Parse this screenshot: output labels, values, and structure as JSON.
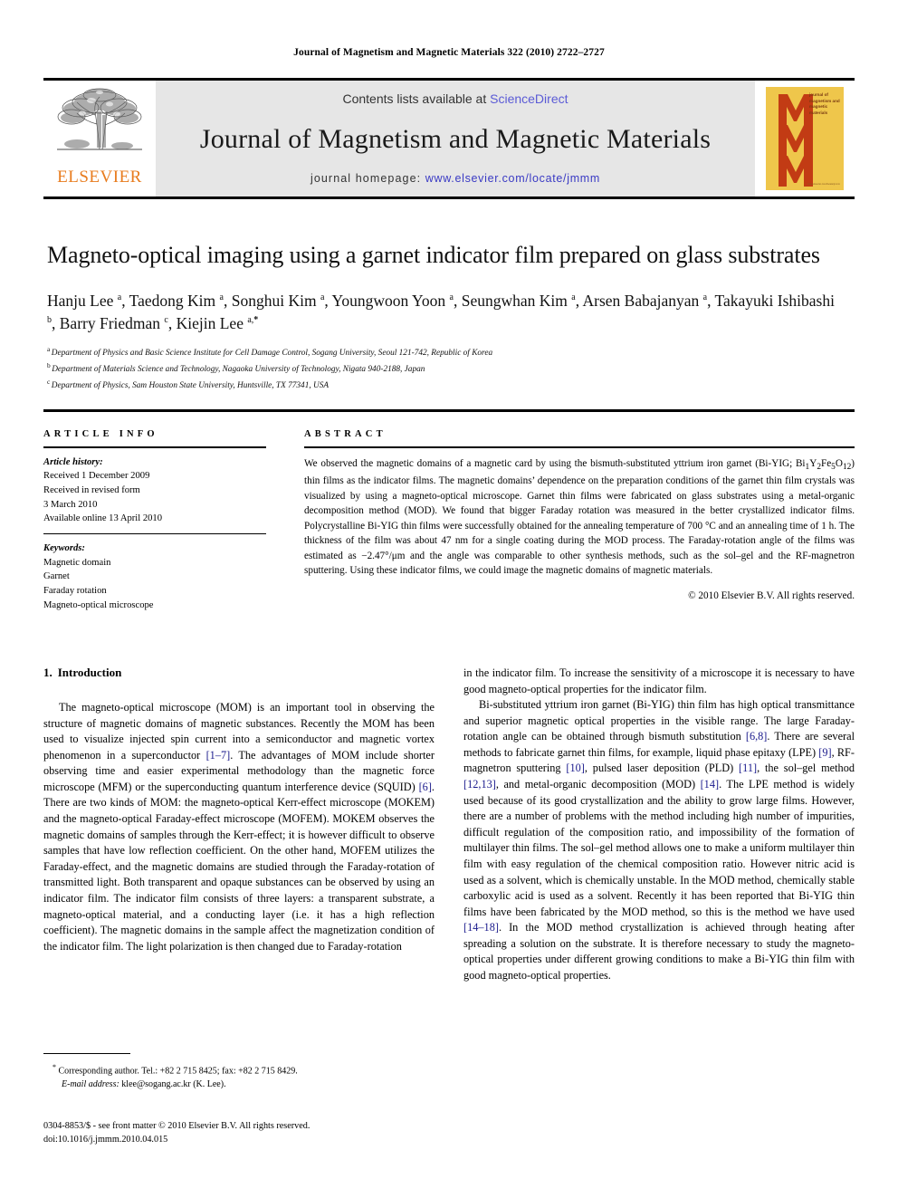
{
  "running_head": "Journal of Magnetism and Magnetic Materials 322 (2010) 2722–2727",
  "masthead": {
    "contents_prefix": "Contents lists available at ",
    "sciencedirect": "ScienceDirect",
    "journal_name": "Journal of Magnetism and Magnetic Materials",
    "homepage_prefix": "journal homepage: ",
    "homepage_url": "www.elsevier.com/locate/jmmm",
    "elsevier_word": "ELSEVIER",
    "cover_title": "journal of magnetism and magnetic materials",
    "cover_footer": "www.elsevier.com/locate/jmmm",
    "colors": {
      "elsevier_orange": "#E87C1E",
      "sciencedirect_blue": "#5b5bd6",
      "url_blue": "#3a3ac4",
      "cover_yellow": "#EFC64B",
      "cover_red": "#C23B14",
      "band_grey": "#e6e6e6"
    }
  },
  "title": "Magneto-optical imaging using a garnet indicator film prepared on glass substrates",
  "authors_html": "Hanju Lee <sup>a</sup>, Taedong Kim <sup>a</sup>, Songhui Kim <sup>a</sup>, Youngwoon Yoon <sup>a</sup>, Seungwhan Kim <sup>a</sup>, Arsen Babajanyan <sup>a</sup>, Takayuki Ishibashi <sup>b</sup>, Barry Friedman <sup>c</sup>, Kiejin Lee <sup>a,<b>*</b></sup>",
  "affiliations": [
    {
      "marker": "a",
      "text": "Department of Physics and Basic Science Institute for Cell Damage Control, Sogang University, Seoul 121-742, Republic of Korea"
    },
    {
      "marker": "b",
      "text": "Department of Materials Science and Technology, Nagaoka University of Technology, Nigata 940-2188, Japan"
    },
    {
      "marker": "c",
      "text": "Department of Physics, Sam Houston State University, Huntsville, TX 77341, USA"
    }
  ],
  "article_info": {
    "heading": "ARTICLE INFO",
    "history_label": "Article history:",
    "history_lines": [
      "Received 1 December 2009",
      "Received in revised form",
      "3 March 2010",
      "Available online 13 April 2010"
    ],
    "keywords_label": "Keywords:",
    "keywords": [
      "Magnetic domain",
      "Garnet",
      "Faraday rotation",
      "Magneto-optical microscope"
    ]
  },
  "abstract": {
    "heading": "ABSTRACT",
    "body_html": "We observed the magnetic domains of a magnetic card by using the bismuth-substituted yttrium iron garnet (Bi-YIG; Bi<sub>1</sub>Y<sub>2</sub>Fe<sub>5</sub>O<sub>12</sub>) thin films as the indicator films. The magnetic domains&rsquo; dependence on the preparation conditions of the garnet thin film crystals was visualized by using a magneto-optical microscope. Garnet thin films were fabricated on glass substrates using a metal-organic decomposition method (MOD). We found that bigger Faraday rotation was measured in the better crystallized indicator films. Polycrystalline Bi-YIG thin films were successfully obtained for the annealing temperature of 700 &deg;C and an annealing time of 1 h. The thickness of the film was about 47 nm for a single coating during the MOD process. The Faraday-rotation angle of the films was estimated as &minus;2.47&deg;/&mu;m and the angle was comparable to other synthesis methods, such as the sol&ndash;gel and the RF-magnetron sputtering. Using these indicator films, we could image the magnetic domains of magnetic materials.",
    "copyright": "© 2010 Elsevier B.V. All rights reserved."
  },
  "main": {
    "section_number": "1.",
    "section_title": "Introduction",
    "left_paragraphs_html": [
      "The magneto-optical microscope (MOM) is an important tool in observing the structure of magnetic domains of magnetic substances. Recently the MOM has been used to visualize injected spin current into a semiconductor and magnetic vortex phenomenon in a superconductor <span class=\"ref\">[1–7]</span>. The advantages of MOM include shorter observing time and easier experimental methodology than the magnetic force microscope (MFM) or the superconducting quantum interference device (SQUID) <span class=\"ref\">[6]</span>. There are two kinds of MOM: the magneto-optical Kerr-effect microscope (MOKEM) and the magneto-optical Faraday-effect microscope (MOFEM). MOKEM observes the magnetic domains of samples through the Kerr-effect; it is however difficult to observe samples that have low reflection coefficient. On the other hand, MOFEM utilizes the Faraday-effect, and the magnetic domains are studied through the Faraday-rotation of transmitted light. Both transparent and opaque substances can be observed by using an indicator film. The indicator film consists of three layers: a transparent substrate, a magneto-optical material, and a conducting layer (i.e. it has a high reflection coefficient). The magnetic domains in the sample affect the magnetization condition of the indicator film. The light polarization is then changed due to Faraday-rotation"
    ],
    "right_paragraphs_html": [
      "in the indicator film. To increase the sensitivity of a microscope it is necessary to have good magneto-optical properties for the indicator film.",
      "Bi-substituted yttrium iron garnet (Bi-YIG) thin film has high optical transmittance and superior magnetic optical properties in the visible range. The large Faraday-rotation angle can be obtained through bismuth substitution <span class=\"ref\">[6,8]</span>. There are several methods to fabricate garnet thin films, for example, liquid phase epitaxy (LPE) <span class=\"ref\">[9]</span>, RF-magnetron sputtering <span class=\"ref\">[10]</span>, pulsed laser deposition (PLD) <span class=\"ref\">[11]</span>, the sol–gel method <span class=\"ref\">[12,13]</span>, and metal-organic decomposition (MOD) <span class=\"ref\">[14]</span>. The LPE method is widely used because of its good crystallization and the ability to grow large films. However, there are a number of problems with the method including high number of impurities, difficult regulation of the composition ratio, and impossibility of the formation of multilayer thin films. The sol–gel method allows one to make a uniform multilayer thin film with easy regulation of the chemical composition ratio. However nitric acid is used as a solvent, which is chemically unstable. In the MOD method, chemically stable carboxylic acid is used as a solvent. Recently it has been reported that Bi-YIG thin films have been fabricated by the MOD method, so this is the method we have used <span class=\"ref\">[14–18]</span>. In the MOD method crystallization is achieved through heating after spreading a solution on the substrate. It is therefore necessary to study the magneto-optical properties under different growing conditions to make a Bi-YIG thin film with good magneto-optical properties."
    ]
  },
  "footnote": {
    "corresponding_html": "<sup>*</sup> Corresponding author. Tel.: +82 2 715 8425; fax: +82 2 715 8429.",
    "email_html": "<span class=\"ital\">E-mail address:</span> klee@sogang.ac.kr (K. Lee)."
  },
  "imprint": {
    "line1": "0304-8853/$ - see front matter © 2010 Elsevier B.V. All rights reserved.",
    "line2": "doi:10.1016/j.jmmm.2010.04.015"
  }
}
